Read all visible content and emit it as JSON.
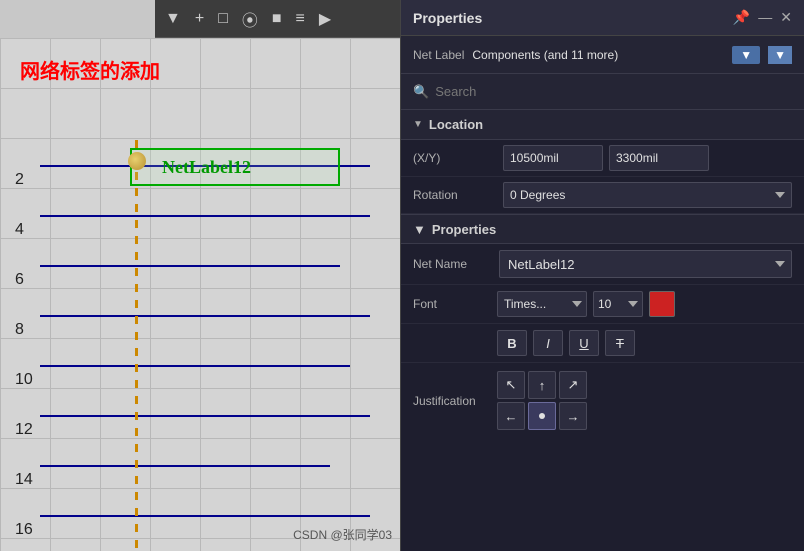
{
  "panel": {
    "title": "Properties",
    "header_icons": [
      "▼",
      "—",
      "✕"
    ],
    "filter_label": "Net Label",
    "filter_value": "Components (and 11 more)",
    "filter_button_label": "▼",
    "search_placeholder": "Search"
  },
  "location": {
    "section_label": "Location",
    "x_label": "(X/Y)",
    "x_value": "10500mil",
    "y_value": "3300mil",
    "rotation_label": "Rotation",
    "rotation_value": "0 Degrees"
  },
  "properties": {
    "section_label": "Properties",
    "net_name_label": "Net Name",
    "net_name_value": "NetLabel12",
    "font_label": "Font",
    "font_value": "Times...",
    "font_size": "10",
    "bold_label": "B",
    "italic_label": "I",
    "underline_label": "U",
    "strikethrough_label": "T",
    "justification_label": "Justification"
  },
  "canvas": {
    "chinese_text": "网络标签的添加",
    "netlabel": "NetLabel12",
    "row_numbers": [
      "2",
      "4",
      "6",
      "8",
      "10",
      "12",
      "14",
      "16"
    ],
    "watermark": "CSDN @张同学03"
  },
  "toolbar": {
    "icons": [
      "▼",
      "+",
      "□",
      "|||",
      "■",
      "≡",
      "▶"
    ]
  }
}
